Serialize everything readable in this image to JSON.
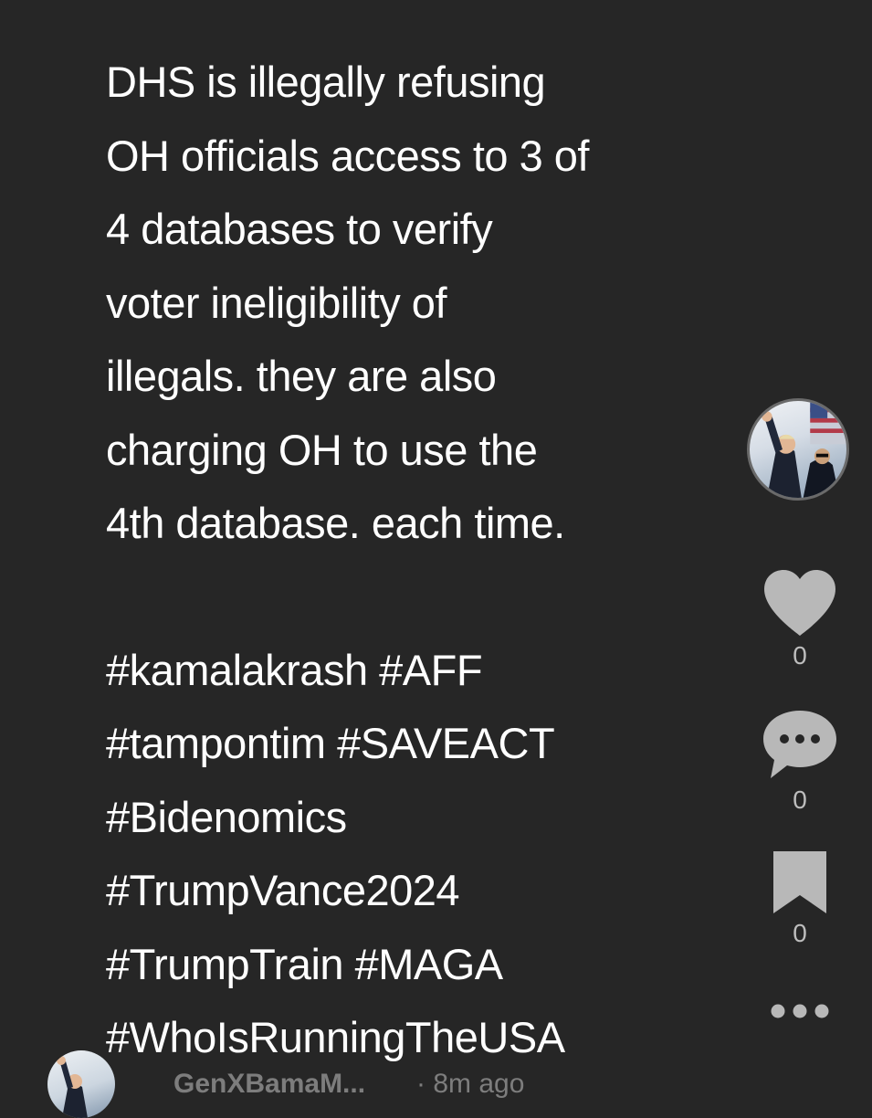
{
  "post": {
    "lines": [
      "DHS is illegally refusing",
      "OH officials access to 3 of",
      "4 databases to verify",
      "voter ineligibility of",
      "illegals. they are also",
      "charging OH to use the",
      "4th database. each time."
    ],
    "hashtag_lines": [
      "#kamalakrash #AFF",
      "#tampontim #SAVEACT",
      "#Bidenomics",
      "#TrumpVance2024",
      "#TrumpTrain #MAGA",
      "#WhoIsRunningTheUSA"
    ]
  },
  "actions": {
    "like_count": "0",
    "comment_count": "0",
    "save_count": "0"
  },
  "footer": {
    "author": "GenXBamaM...",
    "time": "· 8m ago"
  },
  "colors": {
    "background": "#262626",
    "icon": "#b8b8b8",
    "muted_text": "#7d7d7d"
  }
}
